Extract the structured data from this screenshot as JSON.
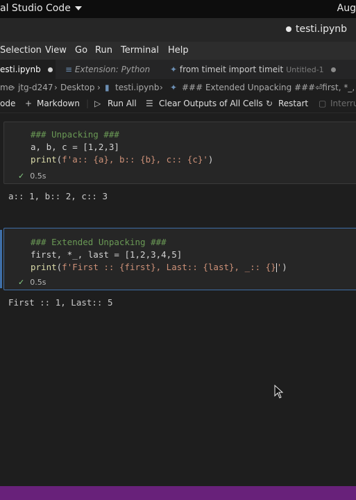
{
  "system": {
    "app_title": "al Studio Code",
    "date": "Aug"
  },
  "window": {
    "title": "testi.ipynb"
  },
  "menu": {
    "items": [
      "Selection",
      "View",
      "Go",
      "Run",
      "Terminal",
      "Help"
    ]
  },
  "tabs": [
    {
      "label": "esti.ipynb",
      "modified": true
    },
    {
      "label": "Extension: Python"
    },
    {
      "label": "from timeit import timeit",
      "sublabel": "Untitled-1",
      "modified": true
    }
  ],
  "breadcrumb": [
    "me",
    "jtg-d247",
    "Desktop",
    "testi.ipynb",
    "### Extended Unpacking ###⏎first, *_, last"
  ],
  "toolbar": {
    "code": "ode",
    "markdown": "Markdown",
    "run_all": "Run All",
    "clear_outputs": "Clear Outputs of All Cells",
    "restart": "Restart",
    "interrupt": "Interru"
  },
  "cells": [
    {
      "lines": {
        "l1": "### Unpacking ###",
        "l2": "a, b, c = [1,2,3]",
        "l3_fn": "print",
        "l3_open": "(",
        "l3_str": "f'a:: {a}, b:: {b}, c:: {c}'",
        "l3_close": ")"
      },
      "time": "0.5s",
      "output": "a:: 1, b:: 2, c:: 3"
    },
    {
      "lines": {
        "l1": "### Extended Unpacking ###",
        "l2": "first, *_, last = [1,2,3,4,5]",
        "l3_fn": "print",
        "l3_open": "(",
        "l3_str": "f'First :: {first}, Last:: {last}, _:: {}",
        "l3_str_end": "'",
        "l3_close": ")"
      },
      "time": "0.5s",
      "output": "First :: 1, Last:: 5"
    }
  ],
  "colors": {
    "status_bar": "#68217a",
    "focus": "#3f6fa8"
  }
}
